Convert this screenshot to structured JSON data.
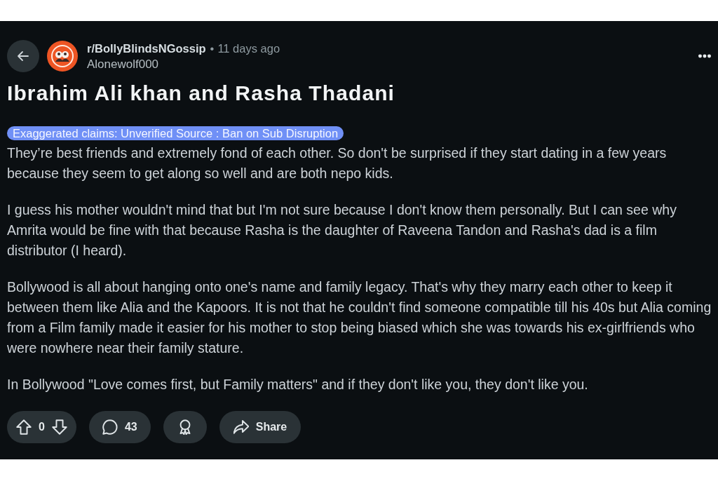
{
  "post": {
    "subreddit": "r/BollyBlindsNGossip",
    "separator": "•",
    "age": "11 days ago",
    "author": "Alonewolf000",
    "title": "Ibrahim Ali khan and Rasha Thadani",
    "flair": "Exaggerated claims: Unverified Source : Ban on Sub Disruption",
    "paragraphs": [
      "They’re best friends and extremely fond of each other. So don't be surprised if they start dating in a few years because they seem to get along so well and are both nepo kids.",
      "I guess his mother wouldn't mind that but I'm not sure because I don't know them personally. But I can see why Amrita would be fine with that because Rasha is the daughter of Raveena Tandon and Rasha's dad is a film distributor (I heard).",
      "Bollywood is all about hanging onto one's name and family legacy. That's why they marry each other to keep it between them like Alia and the Kapoors. It is not that he couldn't find someone compatible till his 40s but Alia coming from a Film family made it easier for his mother to stop being biased which she was towards his ex-girlfriends who were nowhere near their family stature.",
      "In Bollywood \"Love comes first, but Family matters\" and if they don't like you, they don't like you."
    ]
  },
  "actions": [
    {
      "kind": "vote",
      "text": "0"
    },
    {
      "kind": "comments",
      "text": "43"
    },
    {
      "kind": "award"
    },
    {
      "kind": "share",
      "text": "Share"
    }
  ]
}
